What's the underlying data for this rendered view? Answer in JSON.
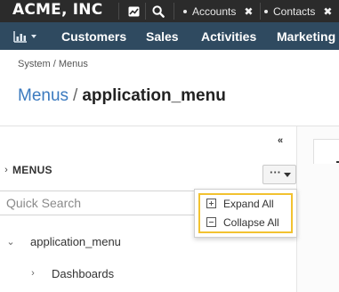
{
  "topbar": {
    "brand": "ACME, INC",
    "tabs": [
      {
        "label": "Accounts",
        "close": "✖"
      },
      {
        "label": "Contacts",
        "close": "✖"
      }
    ],
    "icons": [
      "dashboard-icon",
      "search-icon"
    ]
  },
  "nav": {
    "menu_icon": "bar-chart-icon",
    "items": [
      "Customers",
      "Sales",
      "Activities",
      "Marketing"
    ]
  },
  "breadcrumb": "System / Menus",
  "page_title": {
    "parent": "Menus",
    "separator": "/",
    "current": "application_menu"
  },
  "tree": {
    "collapse_glyph": "«",
    "header_chevron": "›",
    "header": "MENUS",
    "more_label": "···",
    "search_placeholder": "Quick Search",
    "nodes": [
      {
        "label": "application_menu",
        "chevron": "⌄"
      },
      {
        "label": "Dashboards",
        "chevron": "›"
      }
    ]
  },
  "dropdown": {
    "items": [
      {
        "label": "Expand All",
        "icon": "plus-square-icon"
      },
      {
        "label": "Collapse All",
        "icon": "minus-square-icon"
      }
    ]
  },
  "colors": {
    "topbar": "#2b2b2b",
    "navbar": "#2f4a60",
    "link": "#3b7abf",
    "highlight": "#f2c230"
  }
}
